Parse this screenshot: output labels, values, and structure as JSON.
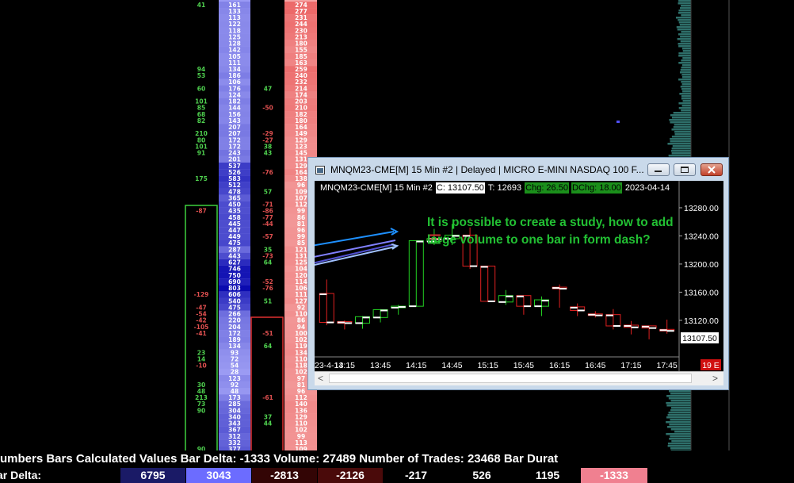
{
  "ladder": {
    "left_values": [
      {
        "row": 0,
        "text": "41",
        "color": "#4fd14f"
      },
      {
        "row": 10,
        "text": "94",
        "color": "#4fd14f"
      },
      {
        "row": 11,
        "text": "53",
        "color": "#4fd14f"
      },
      {
        "row": 13,
        "text": "60",
        "color": "#4fd14f"
      },
      {
        "row": 15,
        "text": "101",
        "color": "#4fd14f"
      },
      {
        "row": 16,
        "text": "85",
        "color": "#4fd14f"
      },
      {
        "row": 17,
        "text": "68",
        "color": "#4fd14f"
      },
      {
        "row": 18,
        "text": "82",
        "color": "#4fd14f"
      },
      {
        "row": 20,
        "text": "210",
        "color": "#4fd14f"
      },
      {
        "row": 21,
        "text": "80",
        "color": "#4fd14f"
      },
      {
        "row": 22,
        "text": "101",
        "color": "#4fd14f"
      },
      {
        "row": 23,
        "text": "91",
        "color": "#4fd14f"
      },
      {
        "row": 27,
        "text": "175",
        "color": "#4fd14f"
      },
      {
        "row": 32,
        "text": "-87",
        "color": "#e05050"
      },
      {
        "row": 45,
        "text": "-129",
        "color": "#e05050"
      },
      {
        "row": 47,
        "text": "-47",
        "color": "#e05050"
      },
      {
        "row": 48,
        "text": "-54",
        "color": "#e05050"
      },
      {
        "row": 49,
        "text": "-42",
        "color": "#e05050"
      },
      {
        "row": 50,
        "text": "-105",
        "color": "#e05050"
      },
      {
        "row": 51,
        "text": "-41",
        "color": "#e05050"
      },
      {
        "row": 54,
        "text": "23",
        "color": "#4fd14f"
      },
      {
        "row": 55,
        "text": "14",
        "color": "#4fd14f"
      },
      {
        "row": 56,
        "text": "-10",
        "color": "#e05050"
      },
      {
        "row": 59,
        "text": "30",
        "color": "#4fd14f"
      },
      {
        "row": 60,
        "text": "48",
        "color": "#4fd14f"
      },
      {
        "row": 61,
        "text": "213",
        "color": "#4fd14f"
      },
      {
        "row": 62,
        "text": "73",
        "color": "#4fd14f"
      },
      {
        "row": 63,
        "text": "90",
        "color": "#4fd14f"
      },
      {
        "row": 69,
        "text": "90",
        "color": "#4fd14f"
      }
    ],
    "mid_values": [
      {
        "row": 13,
        "text": "47",
        "color": "#4fd14f"
      },
      {
        "row": 16,
        "text": "-50",
        "color": "#e05050"
      },
      {
        "row": 20,
        "text": "-29",
        "color": "#e05050"
      },
      {
        "row": 21,
        "text": "-27",
        "color": "#e05050"
      },
      {
        "row": 22,
        "text": "38",
        "color": "#4fd14f"
      },
      {
        "row": 23,
        "text": "43",
        "color": "#4fd14f"
      },
      {
        "row": 26,
        "text": "-76",
        "color": "#e05050"
      },
      {
        "row": 29,
        "text": "57",
        "color": "#4fd14f"
      },
      {
        "row": 31,
        "text": "-71",
        "color": "#e05050"
      },
      {
        "row": 32,
        "text": "-86",
        "color": "#e05050"
      },
      {
        "row": 33,
        "text": "-77",
        "color": "#e05050"
      },
      {
        "row": 34,
        "text": "-44",
        "color": "#e05050"
      },
      {
        "row": 36,
        "text": "-57",
        "color": "#e05050"
      },
      {
        "row": 38,
        "text": "35",
        "color": "#4fd14f"
      },
      {
        "row": 39,
        "text": "-73",
        "color": "#e05050"
      },
      {
        "row": 40,
        "text": "64",
        "color": "#4fd14f"
      },
      {
        "row": 43,
        "text": "-52",
        "color": "#e05050"
      },
      {
        "row": 44,
        "text": "-76",
        "color": "#e05050"
      },
      {
        "row": 46,
        "text": "51",
        "color": "#4fd14f"
      },
      {
        "row": 51,
        "text": "-51",
        "color": "#e05050"
      },
      {
        "row": 53,
        "text": "64",
        "color": "#4fd14f"
      },
      {
        "row": 61,
        "text": "-61",
        "color": "#e05050"
      },
      {
        "row": 64,
        "text": "37",
        "color": "#4fd14f"
      },
      {
        "row": 65,
        "text": "44",
        "color": "#4fd14f"
      }
    ],
    "volume": [
      "161",
      "133",
      "113",
      "122",
      "118",
      "125",
      "128",
      "142",
      "105",
      "111",
      "134",
      "186",
      "106",
      "176",
      "124",
      "182",
      "144",
      "156",
      "143",
      "207",
      "207",
      "172",
      "172",
      "243",
      "201",
      "537",
      "526",
      "583",
      "512",
      "478",
      "365",
      "450",
      "435",
      "458",
      "445",
      "447",
      "449",
      "475",
      "287",
      "443",
      "627",
      "746",
      "750",
      "690",
      "803",
      "606",
      "540",
      "475",
      "266",
      "220",
      "204",
      "172",
      "189",
      "134",
      "93",
      "72",
      "54",
      "28",
      "123",
      "92",
      "48",
      "173",
      "285",
      "304",
      "340",
      "343",
      "367",
      "312",
      "332",
      "377"
    ],
    "right_values": [
      "274",
      "277",
      "231",
      "244",
      "230",
      "213",
      "180",
      "155",
      "185",
      "163",
      "259",
      "240",
      "232",
      "214",
      "174",
      "203",
      "210",
      "182",
      "180",
      "164",
      "149",
      "129",
      "123",
      "145",
      "131",
      "129",
      "164",
      "138",
      "96",
      "109",
      "107",
      "112",
      "99",
      "86",
      "81",
      "96",
      "99",
      "85",
      "121",
      "131",
      "125",
      "104",
      "120",
      "114",
      "106",
      "111",
      "127",
      "92",
      "110",
      "86",
      "94",
      "100",
      "102",
      "119",
      "134",
      "110",
      "118",
      "102",
      "97",
      "81",
      "96",
      "112",
      "140",
      "136",
      "129",
      "110",
      "102",
      "99",
      "113",
      "109"
    ]
  },
  "status": {
    "line1": "umbers Bars Calculated Values  Bar Delta: -1333  Volume: 27489  Number of Trades: 23468  Bar Durat",
    "row2_label": "ar Delta:",
    "row2_cells": [
      {
        "value": "6795",
        "bg": "#1a1a66",
        "fg": "#ffffff"
      },
      {
        "value": "3043",
        "bg": "#6c6cff",
        "fg": "#ffffff"
      },
      {
        "value": "-2813",
        "bg": "#330505",
        "fg": "#ffffff"
      },
      {
        "value": "-2126",
        "bg": "#4a0a0a",
        "fg": "#ffffff"
      },
      {
        "value": "-217",
        "bg": "#000000",
        "fg": "#ffffff"
      },
      {
        "value": "526",
        "bg": "#000000",
        "fg": "#ffffff"
      },
      {
        "value": "1195",
        "bg": "#000000",
        "fg": "#ffffff"
      },
      {
        "value": "-1333",
        "bg": "#f08090",
        "fg": "#ffffff"
      }
    ]
  },
  "chart_window": {
    "title": "MNQM23-CME[M]  15 Min   #2 | Delayed | MICRO E-MINI NASDAQ 100 F...",
    "header": {
      "symbol": "MNQM23-CME[M]  15 Min   #2",
      "close": "C: 13107.50",
      "trades": "T: 12693",
      "chg": "Chg: 26.50",
      "dchg": "DChg: 18.00",
      "date": "2023-04-14"
    },
    "question": "It is possible to create a study, how to add  large volume to one bar in form  dash?",
    "price_label": "13107.50",
    "corner_badge": "19 E",
    "scroll_left": "<",
    "scroll_right": ">"
  },
  "chart_data": {
    "type": "candlestick",
    "x": [
      "13:00",
      "13:15",
      "13:30",
      "13:45",
      "14:00",
      "14:15",
      "14:30",
      "14:45",
      "15:00",
      "15:15",
      "15:30",
      "15:45",
      "16:00",
      "16:15",
      "16:30",
      "16:45",
      "17:00",
      "17:15",
      "17:30",
      "17:45"
    ],
    "x_ticks": [
      "23-4-14",
      "13:15",
      "13:45",
      "14:15",
      "14:45",
      "15:15",
      "15:45",
      "16:15",
      "16:45",
      "17:15",
      "17:45"
    ],
    "y_ticks": [
      13280,
      13240,
      13200,
      13160,
      13120
    ],
    "ylim": [
      13068,
      13298
    ],
    "bars": [
      {
        "o": 13157,
        "h": 13178,
        "l": 13113,
        "c": 13117
      },
      {
        "o": 13117,
        "h": 13120,
        "l": 13107,
        "c": 13116
      },
      {
        "o": 13116,
        "h": 13126,
        "l": 13108,
        "c": 13124
      },
      {
        "o": 13124,
        "h": 13136,
        "l": 13117,
        "c": 13134
      },
      {
        "o": 13138,
        "h": 13142,
        "l": 13128,
        "c": 13139
      },
      {
        "o": 13140,
        "h": 13232,
        "l": 13140,
        "c": 13232
      },
      {
        "o": 13232,
        "h": 13250,
        "l": 13227,
        "c": 13235
      },
      {
        "o": 13236,
        "h": 13257,
        "l": 13227,
        "c": 13240
      },
      {
        "o": 13240,
        "h": 13252,
        "l": 13193,
        "c": 13197
      },
      {
        "o": 13196,
        "h": 13197,
        "l": 13146,
        "c": 13147
      },
      {
        "o": 13146,
        "h": 13163,
        "l": 13142,
        "c": 13154
      },
      {
        "o": 13154,
        "h": 13154,
        "l": 13128,
        "c": 13140
      },
      {
        "o": 13140,
        "h": 13154,
        "l": 13126,
        "c": 13148
      },
      {
        "o": 13166,
        "h": 13171,
        "l": 13138,
        "c": 13165
      },
      {
        "o": 13138,
        "h": 13144,
        "l": 13126,
        "c": 13134
      },
      {
        "o": 13128,
        "h": 13133,
        "l": 13124,
        "c": 13127
      },
      {
        "o": 13127,
        "h": 13136,
        "l": 13107,
        "c": 13112
      },
      {
        "o": 13112,
        "h": 13119,
        "l": 13100,
        "c": 13110
      },
      {
        "o": 13111,
        "h": 13112,
        "l": 13093,
        "c": 13109
      },
      {
        "o": 13106,
        "h": 13121,
        "l": 13101,
        "c": 13105
      }
    ]
  }
}
